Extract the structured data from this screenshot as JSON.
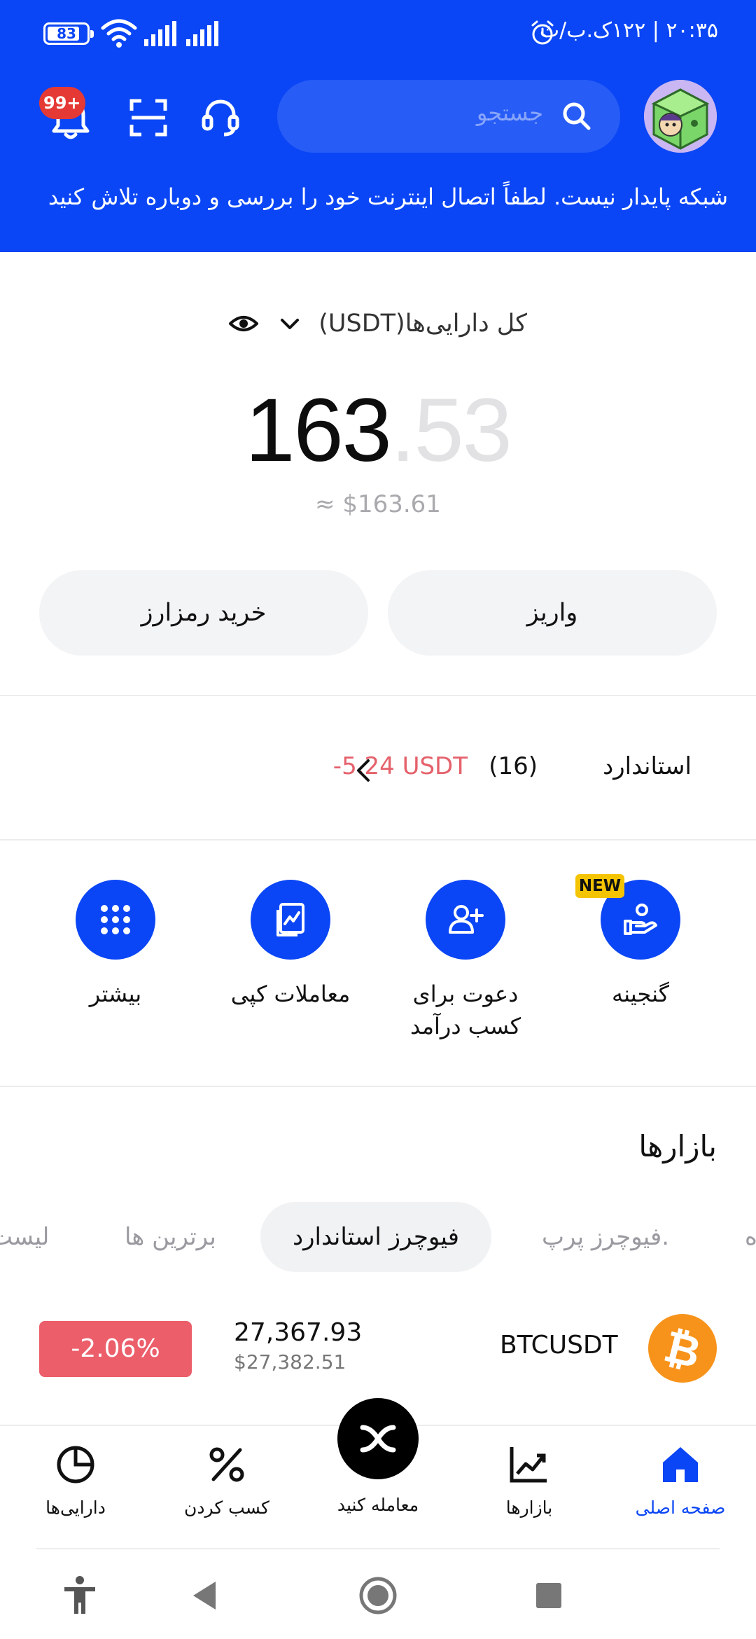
{
  "status_bar": {
    "time_text": "۲۰:۳۵ | ۱۲۲ک.ب/ث",
    "battery": "83",
    "battery_level": 0.83
  },
  "header": {
    "notification_badge": "99+",
    "search_placeholder": "جستجو",
    "network_warning": "شبکه پایدار نیست. لطفاً اتصال اینترنت خود را بررسی و دوباره تلاش کنید",
    "brand_color": "#0A46F5"
  },
  "balance": {
    "title": "کل دارایی‌ها(USDT)",
    "amount_int": "163",
    "amount_dec": ".53",
    "usd_approx": "≈ $163.61"
  },
  "actions": {
    "deposit": "واریز",
    "buy_crypto": "خرید رمزارز"
  },
  "account": {
    "label": "استاندارد",
    "count": "(16)",
    "pnl": "-5.24 USDT"
  },
  "shortcuts": {
    "new_badge": "NEW",
    "treasury": "گنجینه",
    "invite": "دعوت برای کسب درآمد",
    "copy_trading": "معاملات کپی",
    "more": "بیشتر"
  },
  "markets": {
    "title": "بازارها",
    "tabs": [
      "ه",
      ".فیوچرز پرپ",
      "فیوچرز استاندارد",
      "برترین ها",
      "لیست"
    ],
    "rows": [
      {
        "symbol": "BTCUSDT",
        "price": "27,367.93",
        "price_usd": "$27,382.51",
        "change": "-2.06%"
      }
    ]
  },
  "tabbar": {
    "home": "صفحه اصلی",
    "markets": "بازارها",
    "trade": "معامله کنید",
    "earn": "کسب کردن",
    "assets": "دارایی‌ها"
  }
}
